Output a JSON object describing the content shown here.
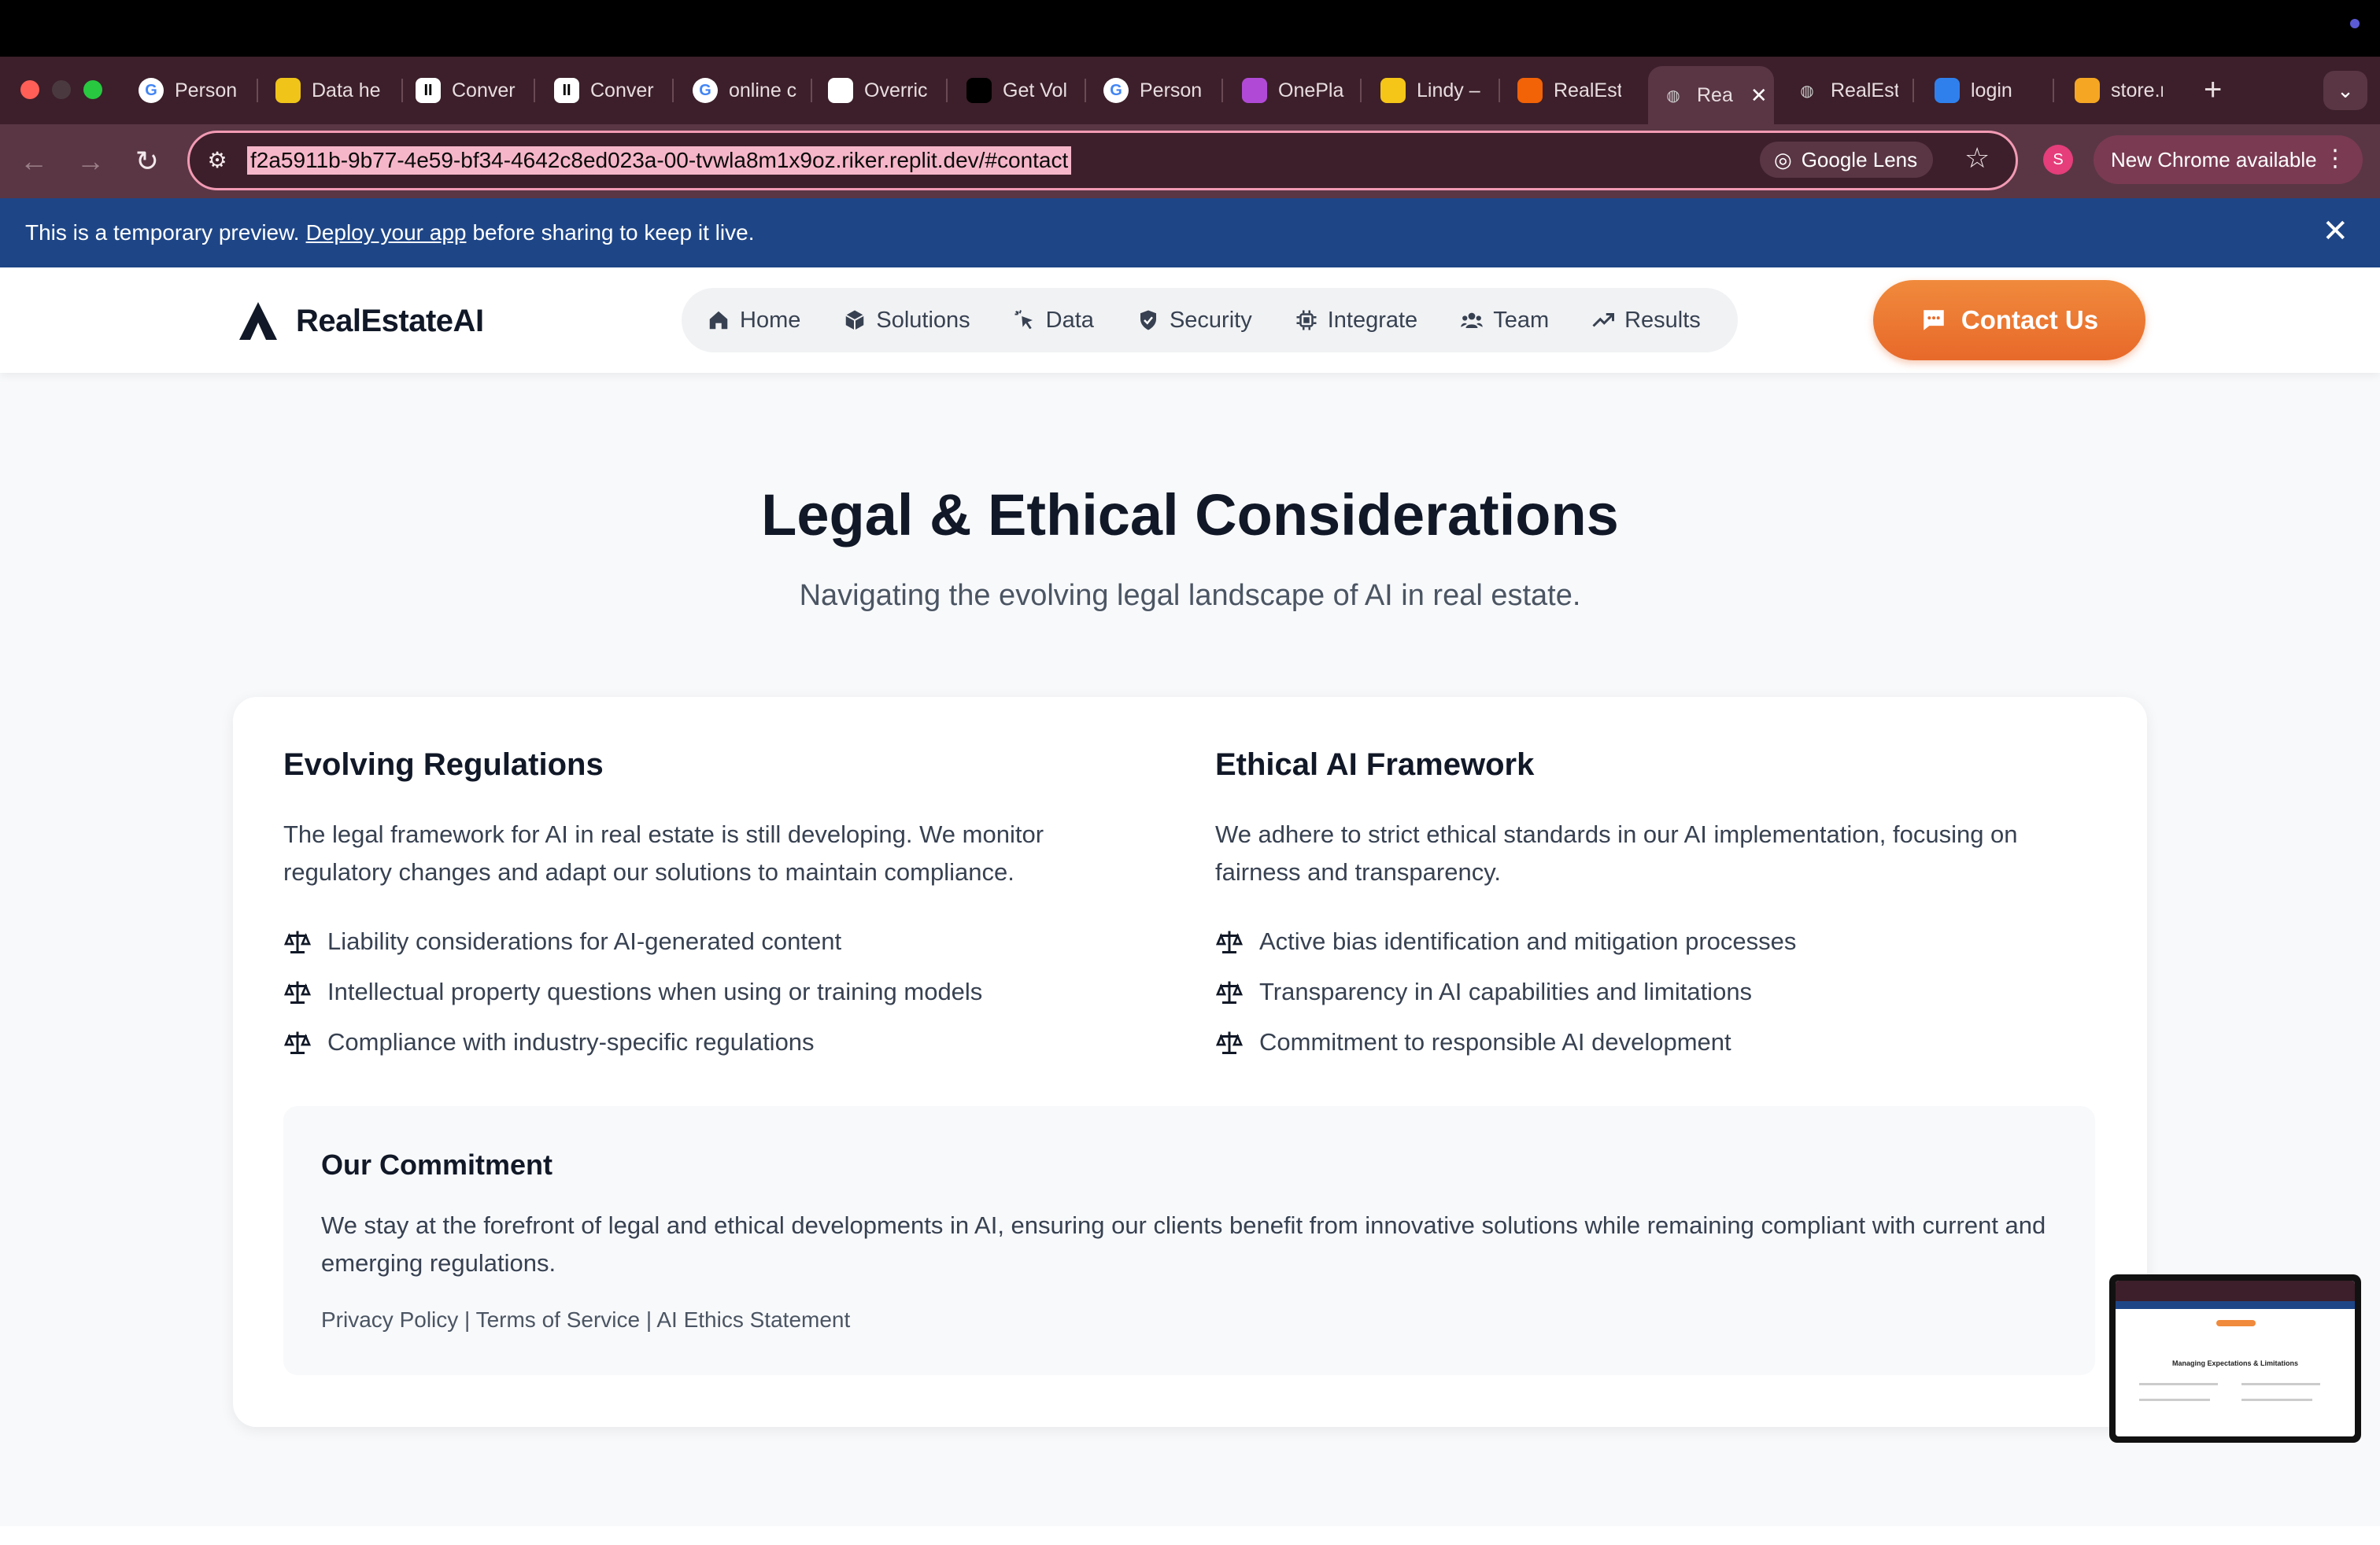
{
  "browser": {
    "tabs": [
      {
        "label": "Person",
        "icon": "google-icon",
        "color": "#4285f4"
      },
      {
        "label": "Data he",
        "icon": "datahub-icon",
        "color": "#f0c419"
      },
      {
        "label": "Conver",
        "icon": "pause-icon",
        "color": "#ffffff"
      },
      {
        "label": "Conver",
        "icon": "pause-icon",
        "color": "#ffffff"
      },
      {
        "label": "online c",
        "icon": "google-icon",
        "color": "#4285f4"
      },
      {
        "label": "Overric",
        "icon": "overridden-icon",
        "color": "#ffffff"
      },
      {
        "label": "Get Vol",
        "icon": "p-icon",
        "color": "#000000"
      },
      {
        "label": "Person",
        "icon": "google-icon",
        "color": "#4285f4"
      },
      {
        "label": "OnePla",
        "icon": "oneplan-icon",
        "color": "#b04ad6"
      },
      {
        "label": "Lindy –",
        "icon": "lindy-icon",
        "color": "#f5c518"
      },
      {
        "label": "RealEst",
        "icon": "replit-icon",
        "color": "#f26207"
      },
      {
        "label": "Rea",
        "icon": "globe-icon",
        "color": "#cccccc",
        "active": true
      },
      {
        "label": "RealEst",
        "icon": "globe-icon",
        "color": "#cccccc"
      },
      {
        "label": "login",
        "icon": "login-icon",
        "color": "#2f80ed"
      },
      {
        "label": "store.re",
        "icon": "store-icon",
        "color": "#f5a623"
      }
    ],
    "url": "f2a5911b-9b77-4e59-bf34-4642c8ed023a-00-tvwla8m1x9oz.riker.replit.dev/#contact",
    "lens_label": "Google Lens",
    "profile_initial": "S",
    "update_label": "New Chrome available"
  },
  "banner": {
    "text_before": "This is a temporary preview.",
    "link": "Deploy your app",
    "text_after": "before sharing to keep it live."
  },
  "site": {
    "brand": "RealEstateAI",
    "nav": [
      {
        "label": "Home",
        "icon": "home-icon"
      },
      {
        "label": "Solutions",
        "icon": "cube-icon"
      },
      {
        "label": "Data",
        "icon": "pointer-icon"
      },
      {
        "label": "Security",
        "icon": "shield-icon"
      },
      {
        "label": "Integrate",
        "icon": "chip-icon"
      },
      {
        "label": "Team",
        "icon": "users-icon"
      },
      {
        "label": "Results",
        "icon": "trending-up-icon"
      }
    ],
    "contact_label": "Contact Us",
    "accent": "#e8692a"
  },
  "section": {
    "title": "Legal & Ethical Considerations",
    "subtitle": "Navigating the evolving legal landscape of AI in real estate.",
    "left": {
      "heading": "Evolving Regulations",
      "body": "The legal framework for AI in real estate is still developing. We monitor regulatory changes and adapt our solutions to maintain compliance.",
      "items": [
        "Liability considerations for AI-generated content",
        "Intellectual property questions when using or training models",
        "Compliance with industry-specific regulations"
      ]
    },
    "right": {
      "heading": "Ethical AI Framework",
      "body": "We adhere to strict ethical standards in our AI implementation, focusing on fairness and transparency.",
      "items": [
        "Active bias identification and mitigation processes",
        "Transparency in AI capabilities and limitations",
        "Commitment to responsible AI development"
      ]
    },
    "commitment": {
      "heading": "Our Commitment",
      "body": "We stay at the forefront of legal and ethical developments in AI, ensuring our clients benefit from innovative solutions while remaining compliant with current and emerging regulations.",
      "links": "Privacy Policy | Terms of Service | AI Ethics Statement"
    }
  },
  "thumbnail": {
    "title": "Managing Expectations & Limitations"
  }
}
